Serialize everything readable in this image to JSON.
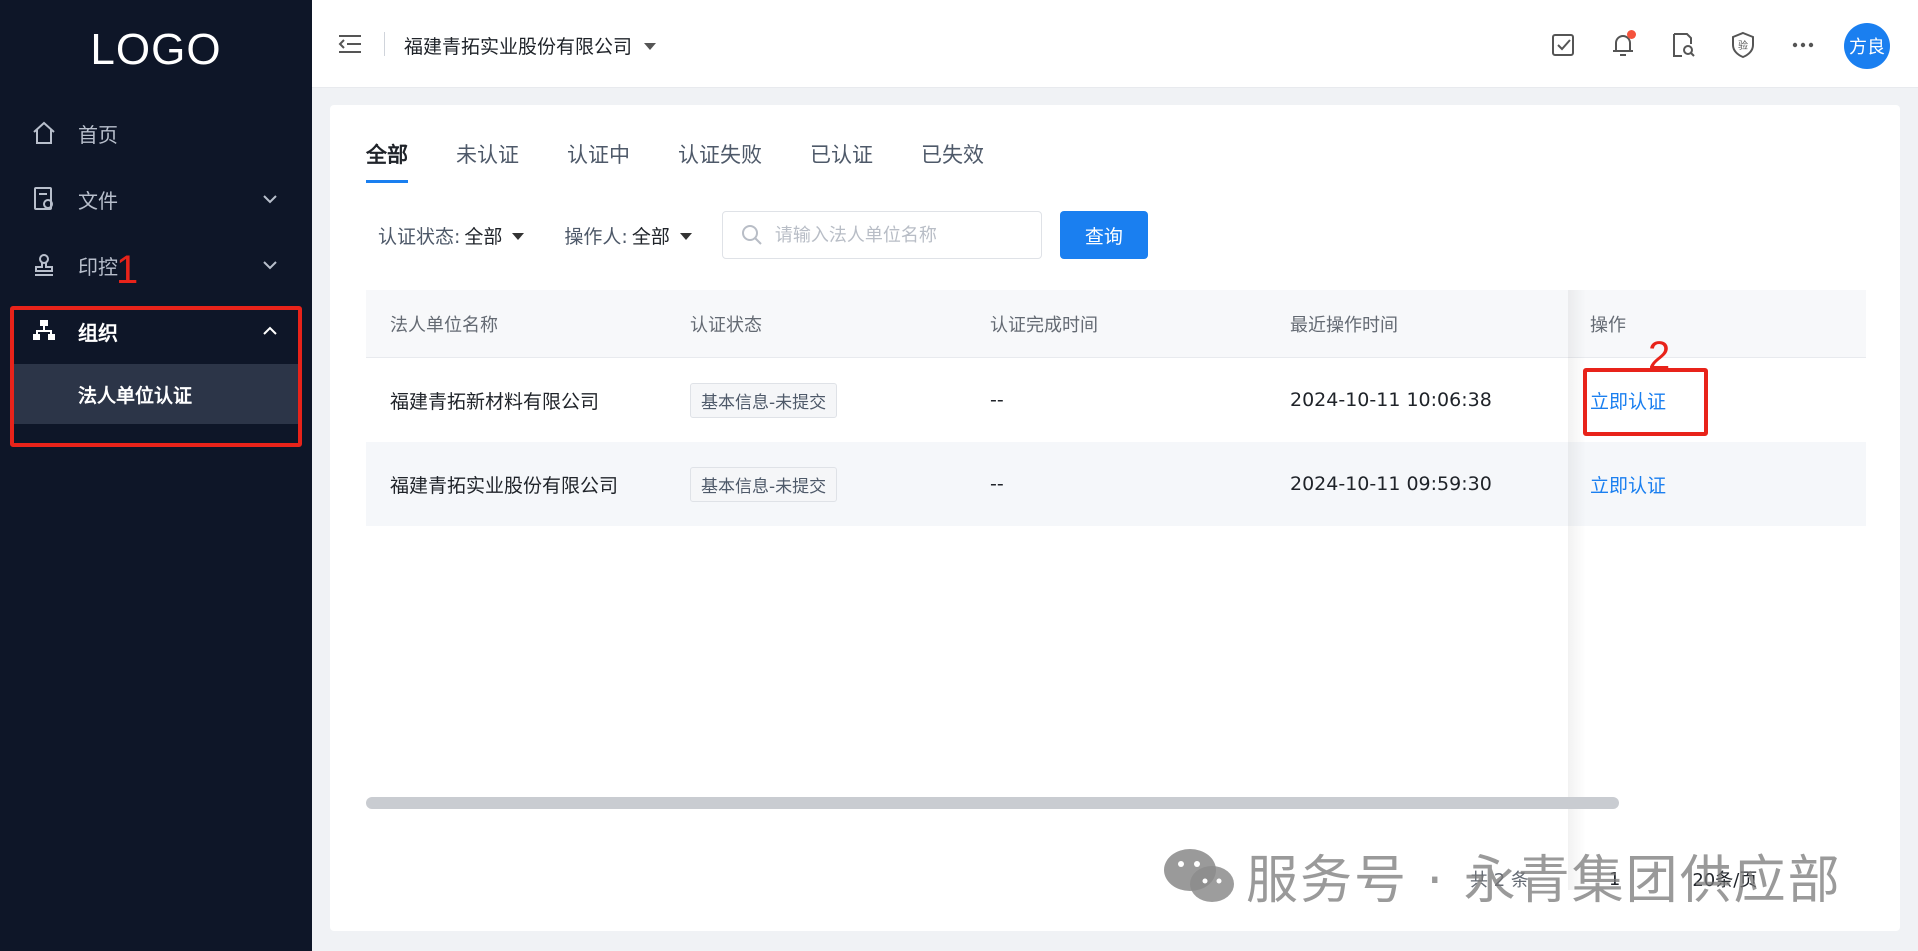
{
  "sidebar": {
    "logo": "LOGO",
    "items": [
      {
        "label": "首页",
        "icon": "home-icon"
      },
      {
        "label": "文件",
        "icon": "file-icon"
      },
      {
        "label": "印控",
        "icon": "stamp-icon"
      },
      {
        "label": "组织",
        "icon": "org-icon"
      }
    ],
    "sub_item": "法人单位认证"
  },
  "annotations": {
    "one": "1",
    "two": "2"
  },
  "header": {
    "company": "福建青拓实业股份有限公司",
    "avatar": "方良"
  },
  "tabs": [
    "全部",
    "未认证",
    "认证中",
    "认证失败",
    "已认证",
    "已失效"
  ],
  "filters": {
    "status_label": "认证状态:",
    "status_value": "全部",
    "operator_label": "操作人:",
    "operator_value": "全部",
    "search_placeholder": "请输入法人单位名称",
    "query_button": "查询"
  },
  "table": {
    "headers": [
      "法人单位名称",
      "认证状态",
      "认证完成时间",
      "最近操作时间",
      "操作"
    ],
    "rows": [
      {
        "name": "福建青拓新材料有限公司",
        "status": "基本信息-未提交",
        "completed": "--",
        "last_op": "2024-10-11 10:06:38",
        "action": "立即认证"
      },
      {
        "name": "福建青拓实业股份有限公司",
        "status": "基本信息-未提交",
        "completed": "--",
        "last_op": "2024-10-11 09:59:30",
        "action": "立即认证"
      }
    ]
  },
  "pagination": {
    "total": "共 2 条",
    "page": "1",
    "page_size": "20条/页"
  },
  "watermark": "服务号 · 永青集团供应部"
}
